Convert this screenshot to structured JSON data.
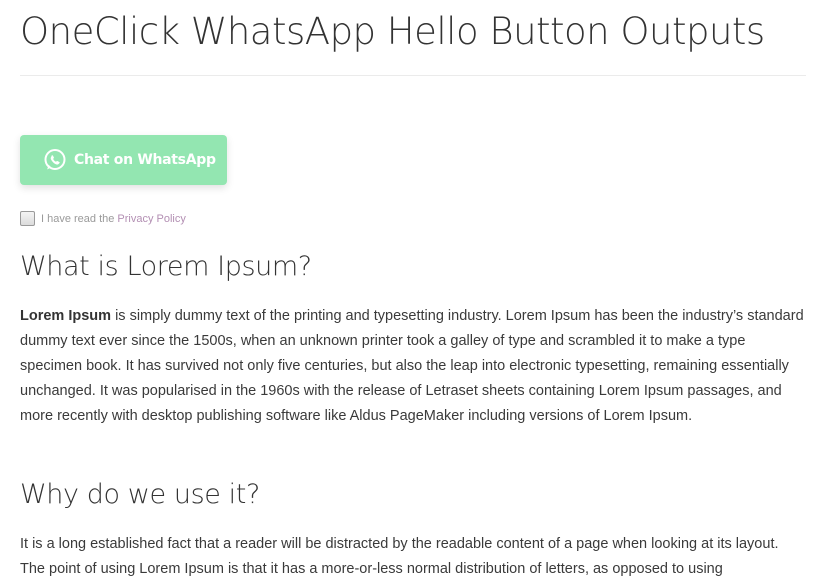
{
  "page": {
    "title": "OneClick WhatsApp Hello Button Outputs"
  },
  "whatsapp_button": {
    "label": "Chat on WhatsApp",
    "icon": "whatsapp-icon",
    "color": "#93e6b1"
  },
  "privacy": {
    "text": "I have read the",
    "link_label": "Privacy Policy",
    "checked": false
  },
  "section1": {
    "heading": "What is Lorem Ipsum?",
    "strong": "Lorem Ipsum",
    "body": " is simply dummy text of the printing and typesetting industry. Lorem Ipsum has been the industry’s standard dummy text ever since the 1500s, when an unknown printer took a galley of type and scrambled it to make a type specimen book. It has survived not only five centuries, but also the leap into electronic typesetting, remaining essentially unchanged. It was popularised in the 1960s with the release of Letraset sheets containing Lorem Ipsum passages, and more recently with desktop publishing software like Aldus PageMaker including versions of Lorem Ipsum."
  },
  "section2": {
    "heading": "Why do we use it?",
    "body": "It is a long established fact that a reader will be distracted by the readable content of a page when looking at its layout. The point of using Lorem Ipsum is that it has a more-or-less normal distribution of letters, as opposed to using"
  }
}
